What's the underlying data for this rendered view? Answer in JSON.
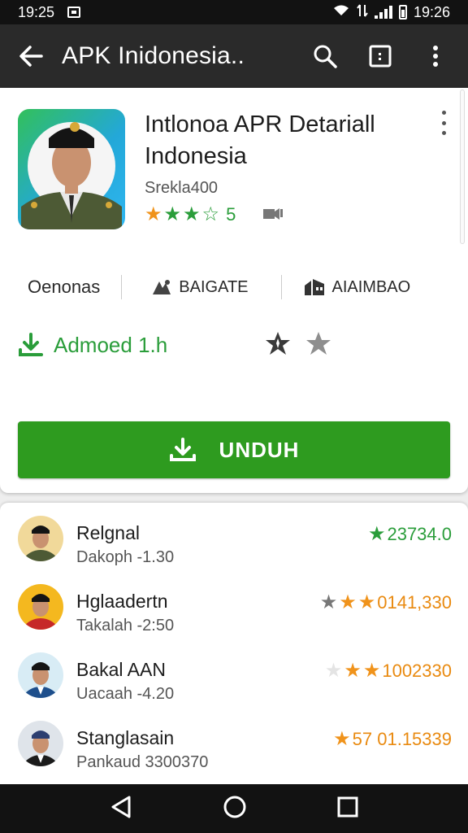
{
  "status_bar": {
    "time_left": "19:25",
    "time_right": "19:26"
  },
  "app_bar": {
    "title": "APK Inidonesia.."
  },
  "app": {
    "title_line1": "Intlonoa APR Detariall",
    "title_line2": "Indonesia",
    "subtitle": "Srekla400",
    "rating_count": "5"
  },
  "meta": [
    {
      "label": "Oenonas"
    },
    {
      "label": "BAIGATE"
    },
    {
      "label": "AIAIMBAO"
    }
  ],
  "installed": {
    "label": "Admoed 1.h"
  },
  "download": {
    "label": "UNDUH"
  },
  "list": [
    {
      "name": "Relgnal",
      "sub": "Dakoph -1.30",
      "value": "23734.0",
      "stars_filled": 1,
      "value_color": "#2a9d3a"
    },
    {
      "name": "Hglaadertn",
      "sub": "Takalah -2:50",
      "value": "0141,330",
      "stars_filled": 2,
      "value_color": "#e98a10"
    },
    {
      "name": "Bakal AAN",
      "sub": "Uacaah -4.20",
      "value": "1002330",
      "stars_filled": 2,
      "value_color": "#e98a10"
    },
    {
      "name": "Stanglasain",
      "sub": "Pankaud 3300370",
      "value": "57 01.15339",
      "stars_filled": 1,
      "value_color": "#e98a10"
    }
  ],
  "colors": {
    "accent_green": "#2e9b1f",
    "star_orange": "#f0931b",
    "star_green": "#2a9d3a"
  },
  "icons": [
    "back-arrow-icon",
    "search-icon",
    "tablet-icon",
    "overflow-icon",
    "download-icon",
    "star-icon",
    "back-nav-icon",
    "home-nav-icon",
    "recents-nav-icon"
  ]
}
